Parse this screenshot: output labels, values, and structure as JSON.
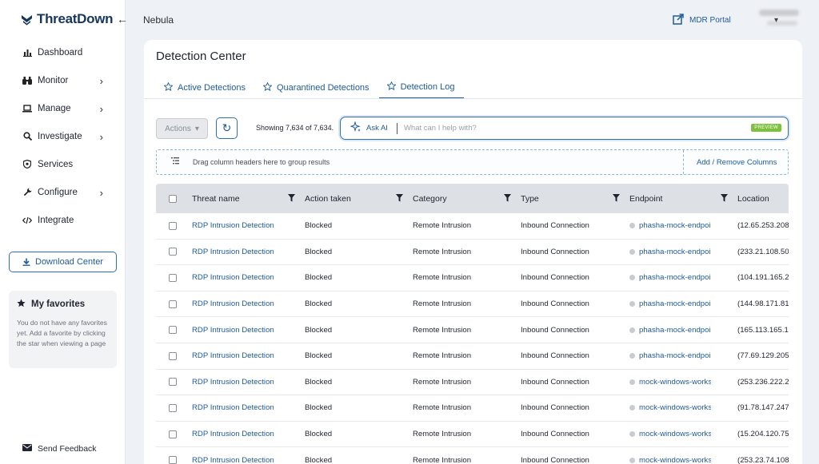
{
  "brand": {
    "name": "ThreatDown"
  },
  "sidebar": {
    "items": [
      {
        "label": "Dashboard",
        "icon": "bar-chart-icon",
        "chevron": false
      },
      {
        "label": "Monitor",
        "icon": "binoculars-icon",
        "chevron": true
      },
      {
        "label": "Manage",
        "icon": "laptop-icon",
        "chevron": true
      },
      {
        "label": "Investigate",
        "icon": "search-icon",
        "chevron": true
      },
      {
        "label": "Services",
        "icon": "shield-icon",
        "chevron": false
      },
      {
        "label": "Configure",
        "icon": "wrench-icon",
        "chevron": true
      },
      {
        "label": "Integrate",
        "icon": "code-icon",
        "chevron": false
      }
    ],
    "download_label": "Download Center",
    "favorites": {
      "title": "My favorites",
      "empty_text": "You do not have any favorites yet. Add a favorite by clicking the star when viewing a page"
    },
    "feedback_label": "Send Feedback"
  },
  "topbar": {
    "breadcrumb": "Nebula",
    "mdr_portal": "MDR Portal"
  },
  "page": {
    "title": "Detection Center",
    "tabs": [
      {
        "label": "Active Detections",
        "active": false
      },
      {
        "label": "Quarantined Detections",
        "active": false
      },
      {
        "label": "Detection Log",
        "active": true
      }
    ]
  },
  "toolbar": {
    "actions_label": "Actions",
    "showing_text": "Showing 7,634 of 7,634.",
    "ask_ai_label": "Ask AI",
    "ask_placeholder": "What can I help with?",
    "preview_badge": "PREVIEW",
    "group_hint": "Drag column headers here to group results",
    "add_remove_columns": "Add / Remove Columns"
  },
  "table": {
    "columns": [
      "Threat name",
      "Action taken",
      "Category",
      "Type",
      "Endpoint",
      "Location"
    ],
    "rows": [
      {
        "threat": "RDP Intrusion Detection",
        "action": "Blocked",
        "category": "Remote Intrusion",
        "type": "Inbound Connection",
        "endpoint": "phasha-mock-endpoi",
        "location": "(12.65.253.208"
      },
      {
        "threat": "RDP Intrusion Detection",
        "action": "Blocked",
        "category": "Remote Intrusion",
        "type": "Inbound Connection",
        "endpoint": "phasha-mock-endpoi",
        "location": "(233.21.108.50"
      },
      {
        "threat": "RDP Intrusion Detection",
        "action": "Blocked",
        "category": "Remote Intrusion",
        "type": "Inbound Connection",
        "endpoint": "phasha-mock-endpoi",
        "location": "(104.191.165.2"
      },
      {
        "threat": "RDP Intrusion Detection",
        "action": "Blocked",
        "category": "Remote Intrusion",
        "type": "Inbound Connection",
        "endpoint": "phasha-mock-endpoi",
        "location": "(144.98.171.81"
      },
      {
        "threat": "RDP Intrusion Detection",
        "action": "Blocked",
        "category": "Remote Intrusion",
        "type": "Inbound Connection",
        "endpoint": "phasha-mock-endpoi",
        "location": "(165.113.165.1"
      },
      {
        "threat": "RDP Intrusion Detection",
        "action": "Blocked",
        "category": "Remote Intrusion",
        "type": "Inbound Connection",
        "endpoint": "phasha-mock-endpoi",
        "location": "(77.69.129.205"
      },
      {
        "threat": "RDP Intrusion Detection",
        "action": "Blocked",
        "category": "Remote Intrusion",
        "type": "Inbound Connection",
        "endpoint": "mock-windows-works",
        "location": "(253.236.222.2"
      },
      {
        "threat": "RDP Intrusion Detection",
        "action": "Blocked",
        "category": "Remote Intrusion",
        "type": "Inbound Connection",
        "endpoint": "mock-windows-works",
        "location": "(91.78.147.247"
      },
      {
        "threat": "RDP Intrusion Detection",
        "action": "Blocked",
        "category": "Remote Intrusion",
        "type": "Inbound Connection",
        "endpoint": "mock-windows-works",
        "location": "(15.204.120.75"
      },
      {
        "threat": "RDP Intrusion Detection",
        "action": "Blocked",
        "category": "Remote Intrusion",
        "type": "Inbound Connection",
        "endpoint": "mock-windows-works",
        "location": "(253.23.74.108"
      }
    ]
  },
  "colors": {
    "accent": "#1e5a99",
    "brand": "#17365d",
    "preview": "#7ec13e"
  }
}
